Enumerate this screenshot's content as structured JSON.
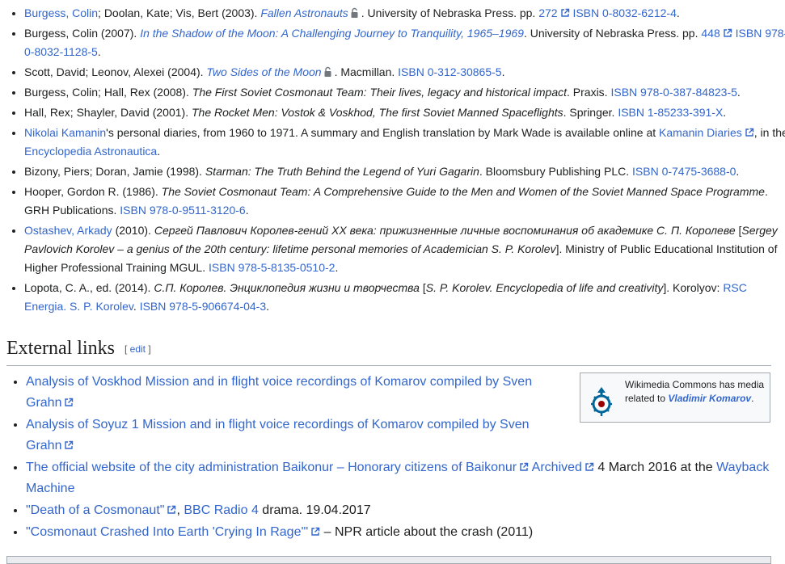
{
  "references": [
    {
      "a1": "Burgess, Colin",
      "t1": "; Doolan, Kate; Vis, Bert (2003). ",
      "title": "Fallen Astronauts",
      "t2": ". University of Nebraska Press. pp. ",
      "pages": "272",
      "isbn": "ISBN 0-8032-6212-4",
      "end": "."
    },
    {
      "t1": "Burgess, Colin (2007). ",
      "title": "In the Shadow of the Moon: A Challenging Journey to Tranquility, 1965–1969",
      "t2": ". University of Nebraska Press. pp. ",
      "pages": "448",
      "isbn": "ISBN 978-0-8032-1128-5",
      "end": "."
    },
    {
      "t1": "Scott, David; Leonov, Alexei (2004). ",
      "title": "Two Sides of the Moon",
      "t2": ". Macmillan. ",
      "isbn": "ISBN 0-312-30865-5",
      "end": "."
    },
    {
      "t1": "Burgess, Colin; Hall, Rex (2008). ",
      "title": "The First Soviet Cosmonaut Team: Their lives, legacy and historical impact",
      "t2": ". Praxis. ",
      "isbn": "ISBN 978-0-387-84823-5",
      "end": "."
    },
    {
      "t1": "Hall, Rex; Shayler, David (2001). ",
      "title": "The Rocket Men: Vostok & Voskhod, The first Soviet Manned Spaceflights",
      "t2": ". Springer. ",
      "isbn": "ISBN 1-85233-391-X",
      "end": "."
    },
    {
      "a1": "Nikolai Kamanin",
      "t1": "'s personal diaries, from 1960 to 1971. A summary and English translation by Mark Wade is available online at ",
      "link": "Kamanin Diaries",
      "t2": ", in the ",
      "a2": "Encyclopedia Astronautica",
      "end": "."
    },
    {
      "t1": "Bizony, Piers; Doran, Jamie (1998). ",
      "title": "Starman: The Truth Behind the Legend of Yuri Gagarin",
      "t2": ". Bloomsbury Publishing PLC. ",
      "isbn": "ISBN 0-7475-3688-0",
      "end": "."
    },
    {
      "t1": "Hooper, Gordon R. (1986). ",
      "title": "The Soviet Cosmonaut Team: A Comprehensive Guide to the Men and Women of the Soviet Manned Space Programme",
      "t2": ". GRH Publications. ",
      "isbn": "ISBN 978-0-9511-3120-6",
      "end": "."
    },
    {
      "a1": "Ostashev, Arkady",
      "t1": " (2010). ",
      "title": "Сергей Павлович Королев-гений ХХ века: прижизненные личные воспоминания об академике С. П. Королеве",
      "t2": " [",
      "trans": "Sergey Pavlovich Korolev – a genius of the 20th century: lifetime personal memories of Academician S. P. Korolev",
      "t3": "]. Ministry of Public Educational Institution of Higher Professional Training MGUL. ",
      "isbn": "ISBN 978-5-8135-0510-2",
      "end": "."
    },
    {
      "t1": "Lopota, C. A., ed. (2014). ",
      "title": "С.П. Королев. Энциклопедия жизни и творчества",
      "t2": " [",
      "trans": "S. P. Korolev. Encyclopedia of life and creativity",
      "t3": "]. Korolyov: ",
      "a2": "RSC Energia. S. P. Korolev",
      "t4": ". ",
      "isbn": "ISBN 978-5-906674-04-3",
      "end": "."
    }
  ],
  "external_links": {
    "heading": "External links",
    "edit": "edit",
    "open_bracket": "[ ",
    "close_bracket": " ]",
    "items": [
      {
        "link": "Analysis of Voskhod Mission and in flight voice recordings of Komarov compiled by Sven Grahn"
      },
      {
        "link": "Analysis of Soyuz 1 Mission and in flight voice recordings of Komarov compiled by Sven Grahn"
      },
      {
        "link": "The official website of the city administration Baikonur – Honorary citizens of Baikonur",
        "space1": " ",
        "archived": "Archived",
        "t1": " 4 March 2016 at the ",
        "wayback": "Wayback Machine"
      },
      {
        "link": "\"Death of a Cosmonaut\"",
        "t1": ", ",
        "a2": "BBC Radio 4",
        "t2": " drama. 19.04.2017"
      },
      {
        "link": "\"Cosmonaut Crashed Into Earth 'Crying In Rage'\"",
        "t1": " – NPR article about the crash (2011)"
      }
    ]
  },
  "commons": {
    "t1": "Wikimedia Commons has media related to ",
    "name": "Vladimir Komarov",
    "end": "."
  },
  "colors": {
    "link": "#3366cc",
    "text": "#202122",
    "border": "#a2a9b1"
  }
}
